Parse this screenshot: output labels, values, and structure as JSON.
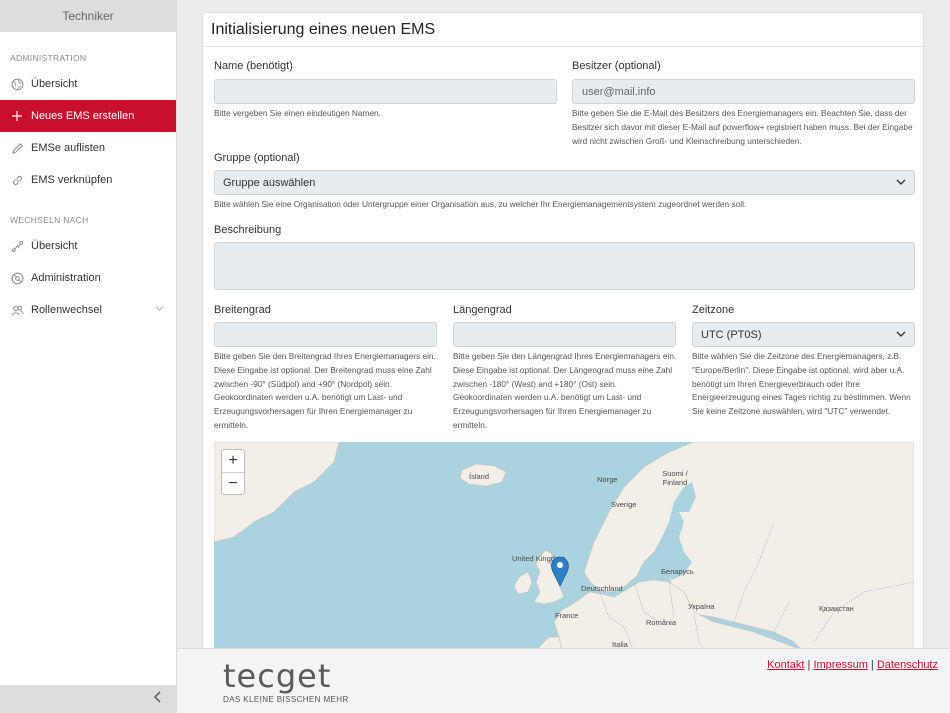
{
  "sidebar": {
    "header": "Techniker",
    "sections": [
      {
        "title": "ADMINISTRATION"
      },
      {
        "title": "WECHSELN NACH"
      }
    ],
    "admin_items": [
      {
        "label": "Übersicht",
        "icon": "globe-icon"
      },
      {
        "label": "Neues EMS erstellen",
        "icon": "plus-icon",
        "active": true
      },
      {
        "label": "EMSe auflisten",
        "icon": "pencil-icon"
      },
      {
        "label": "EMS verknüpfen",
        "icon": "link-icon"
      }
    ],
    "switch_items": [
      {
        "label": "Übersicht",
        "icon": "route-icon"
      },
      {
        "label": "Administration",
        "icon": "settings-icon"
      },
      {
        "label": "Rollenwechsel",
        "icon": "users-icon"
      }
    ],
    "collapse_icon": "chevron-left-icon"
  },
  "form": {
    "title": "Initialisierung eines neuen EMS",
    "name": {
      "label": "Name (benötigt)",
      "value": "",
      "help": "Bitte vergeben Sie einen eindeutigen Namen."
    },
    "owner": {
      "label": "Besitzer (optional)",
      "placeholder": "user@mail.info",
      "help": "Bitte geben Sie die E-Mail des Besitzers des Energiemanagers ein. Beachten Sie, dass der Besitzer sich davor mit dieser E-Mail auf powerflow+ registriert haben muss. Bei der Eingabe wird nicht zwischen Groß- und Kleinschreibung unterschieden."
    },
    "group": {
      "label": "Gruppe (optional)",
      "selected": "Gruppe auswählen",
      "help": "Bitte wählen Sie eine Organisation oder Untergruppe einer Organisation aus, zu welcher Ihr Energiemanagementsystem zugeordnet werden soll."
    },
    "description": {
      "label": "Beschreibung",
      "value": ""
    },
    "latitude": {
      "label": "Breitengrad",
      "value": "",
      "help": "Bitte geben Sie den Breitengrad Ihres Energiemanagers ein. Diese Eingabe ist optional. Der Breitengrad muss eine Zahl zwischen -90° (Südpol) and +90° (Nordpol) sein. Geokoordinaten werden u.A. benötigt um Last- und Erzeugungsvorhersagen für Ihren Energiemanager zu ermitteln."
    },
    "longitude": {
      "label": "Längengrad",
      "value": "",
      "help": "Bitte geben Sie den Längengrad Ihres Energiemanagers ein. Diese Eingabe ist optional. Der Längengrad muss eine Zahl zwischen -180° (West) and +180° (Ost) sein. Geokoordinaten werden u.A. benötigt um Last- und Erzeugungsvorhersagen für Ihren Energiemanager zu ermitteln."
    },
    "timezone": {
      "label": "Zeitzone",
      "selected": "UTC (PT0S)",
      "help": "Bitte wählen Sie die Zeitzone des Energiemanagers, z.B. \"Europe/Berlin\". Diese Eingabe ist optional, wird aber u.A. benötigt um Ihren Energieverbrauch oder Ihre Energieerzeugung eines Tages richtig zu bestimmen. Wenn Sie keine Zeitzone auswählen, wird \"UTC\" verwendet."
    }
  },
  "map": {
    "zoom_in": "+",
    "zoom_out": "−",
    "labels": {
      "iceland": "Ísland",
      "norway": "Norge",
      "sweden": "Sverige",
      "finland": "Suomi / Finland",
      "uk": "United Kingdom",
      "germany": "Deutschland",
      "belarus": "Беларусь",
      "ukraine": "Україна",
      "kazakhstan": "Қазақстан",
      "france": "France",
      "romania": "România",
      "italy": "Italia"
    },
    "marker_icon": "map-pin-icon"
  },
  "footer": {
    "logo_text": "tecget",
    "logo_tagline": "DAS KLEINE BISSCHEN MEHR",
    "links": [
      "Kontakt",
      "Impressum",
      "Datenschutz"
    ],
    "separator": "|"
  },
  "colors": {
    "accent": "#c8102e",
    "sea": "#aad3df",
    "land": "#f2efe9"
  }
}
